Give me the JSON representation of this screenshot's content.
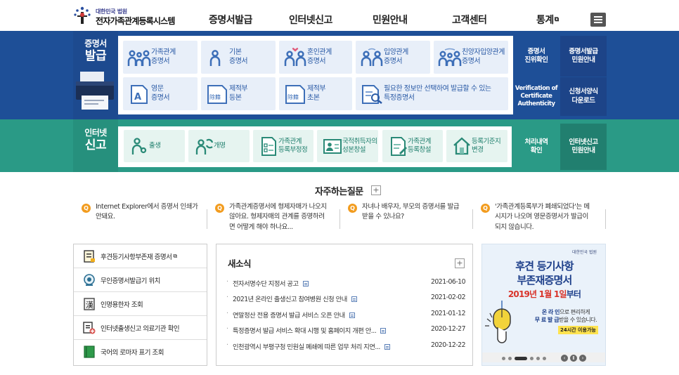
{
  "header": {
    "logo_small": "대한민국 법원",
    "logo_main": "전자가족관계등록시스템",
    "nav": [
      {
        "label": "증명서발급"
      },
      {
        "label": "인터넷신고"
      },
      {
        "label": "민원안내"
      },
      {
        "label": "고객센터"
      },
      {
        "label": "통계",
        "external": true
      }
    ],
    "external_mark": "⧉"
  },
  "issuance": {
    "title_line1": "증명서",
    "title_line2": "발급",
    "tiles": [
      {
        "line1": "가족관계",
        "line2": "증명서",
        "icon": "family-icon"
      },
      {
        "line1": "기본",
        "line2": "증명서",
        "icon": "person-icon"
      },
      {
        "line1": "혼인관계",
        "line2": "증명서",
        "icon": "couple-icon"
      },
      {
        "line1": "입양관계",
        "line2": "증명서",
        "icon": "adoption-icon"
      },
      {
        "line1": "친양자입양관계",
        "line2": "증명서",
        "icon": "family-adoption-icon"
      },
      {
        "line1": "영문",
        "line2": "증명서",
        "icon": "english-doc-icon"
      },
      {
        "line1": "제적부",
        "line2": "등본",
        "icon": "register-copy-icon",
        "badge": "除籍"
      },
      {
        "line1": "제적부",
        "line2": "초본",
        "icon": "register-abstract-icon",
        "badge": "除籍"
      },
      {
        "line1": "필요한 정보만 선택하여 발급할 수 있는",
        "line2": "특정증명서",
        "icon": "search-doc-icon"
      }
    ],
    "side": [
      {
        "line1": "증명서",
        "line2": "진위확인"
      },
      {
        "line1": "증명서발급",
        "line2": "민원안내"
      },
      {
        "line1": "Verification of",
        "line2": "Certificate",
        "line3": "Authenticity"
      },
      {
        "line1": "신청서양식",
        "line2": "다운로드"
      }
    ]
  },
  "report": {
    "title_line1": "인터넷",
    "title_line2": "신고",
    "tiles": [
      {
        "line1": "출생",
        "line2": "",
        "icon": "birth-icon"
      },
      {
        "line1": "개명",
        "line2": "",
        "icon": "rename-icon"
      },
      {
        "line1": "가족관계",
        "line2": "등록부정정",
        "icon": "correction-doc-icon"
      },
      {
        "line1": "국적취득자의",
        "line2": "성본창설",
        "icon": "id-card-icon"
      },
      {
        "line1": "가족관계",
        "line2": "등록창설",
        "icon": "create-doc-icon"
      },
      {
        "line1": "등록기준지",
        "line2": "변경",
        "icon": "house-icon"
      }
    ],
    "side": [
      {
        "line1": "처리내역",
        "line2": "확인"
      },
      {
        "line1": "인터넷신고",
        "line2": "민원안내"
      }
    ]
  },
  "faq": {
    "title": "자주하는질문",
    "plus": "+",
    "q": "Q",
    "items": [
      {
        "line1": "Internet Explorer에서 증명서 인쇄가",
        "line2": "안돼요.",
        "line3": ""
      },
      {
        "line1": "가족관계증명서에 형제자매가 나오지",
        "line2": "않아요. 형제자매의 관계를 증명하려",
        "line3": "면 어떻게 해야 하나요..."
      },
      {
        "line1": "자녀나 배우자, 부모의 증명서를 발급",
        "line2": "받을 수 있나요?",
        "line3": ""
      },
      {
        "line1": "'가족관계등록부가 폐쇄되었다'는 메",
        "line2": "시지가 나오며 영문증명서가 발급이",
        "line3": "되지 않습니다."
      }
    ]
  },
  "quick_links": [
    {
      "label": "후견등기사항부존재 증명서",
      "external": true,
      "icon": "certificate-doc-icon"
    },
    {
      "label": "무인증명서발급기 위치",
      "external": false,
      "icon": "location-pin-icon"
    },
    {
      "label": "인명용한자 조회",
      "external": false,
      "icon": "hanja-book-icon"
    },
    {
      "label": "인터넷출생신고 의료기관 확인",
      "external": false,
      "icon": "hospital-doc-icon"
    },
    {
      "label": "국어의 로마자 표기 조회",
      "external": false,
      "icon": "green-book-icon"
    }
  ],
  "news": {
    "title": "새소식",
    "plus": "+",
    "items": [
      {
        "title": "전자서명수단 지정서 공고",
        "date": "2021-06-10"
      },
      {
        "title": "2021년 온라인 출생신고 참여병원 신청 안내",
        "date": "2021-02-02"
      },
      {
        "title": "연말정산 전용 증명서 발급 서비스 오픈 안내",
        "date": "2021-01-12"
      },
      {
        "title": "특정증명서 발급 서비스 확대 시행 및 홈페이지 개편 안...",
        "date": "2020-12-27"
      },
      {
        "title": "인천광역시 부평구청 민원실 폐쇄에 따른 업무 처리 지연...",
        "date": "2020-12-22"
      }
    ]
  },
  "banner": {
    "logo_small": "대한민국 법원",
    "line1": "후견 등기사항",
    "line2": "부존재증명서",
    "line3_a": "2019년 1월 1일",
    "line3_b": "부터",
    "p1_a": "온 라 인",
    "p1_b": "으로 편리하게",
    "p2_a": "무 료 발 급",
    "p2_b": "받을 수 있습니다.",
    "tag": "24시간 이용가능",
    "ctrl_prev": "‹",
    "ctrl_pause": "Ⅱ",
    "ctrl_next": "›"
  },
  "colors": {
    "blue_band": "#1e4f97",
    "teal_band": "#2a9a86",
    "faq_q": "#f29c1f"
  }
}
